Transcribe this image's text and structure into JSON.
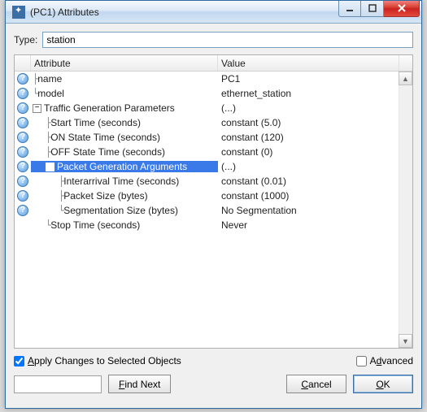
{
  "window": {
    "title": "(PC1) Attributes"
  },
  "type": {
    "label": "Type:",
    "value": "station"
  },
  "columns": {
    "attribute": "Attribute",
    "value": "Value"
  },
  "rows": [
    {
      "indent": 0,
      "branch": "mid",
      "exp": "",
      "label": "name",
      "value": "PC1",
      "help": true,
      "selected": false
    },
    {
      "indent": 0,
      "branch": "last",
      "exp": "",
      "label": "model",
      "value": "ethernet_station",
      "help": true,
      "selected": false
    },
    {
      "indent": 0,
      "branch": "",
      "exp": "minus",
      "label": "Traffic Generation Parameters",
      "value": "(...)",
      "help": true,
      "selected": false
    },
    {
      "indent": 1,
      "branch": "mid",
      "exp": "",
      "label": "Start Time (seconds)",
      "value": "constant (5.0)",
      "help": true,
      "selected": false
    },
    {
      "indent": 1,
      "branch": "mid",
      "exp": "",
      "label": "ON State Time (seconds)",
      "value": "constant (120)",
      "help": true,
      "selected": false
    },
    {
      "indent": 1,
      "branch": "mid",
      "exp": "",
      "label": "OFF State Time (seconds)",
      "value": "constant (0)",
      "help": true,
      "selected": false
    },
    {
      "indent": 1,
      "branch": "mid",
      "exp": "minus",
      "label": "Packet Generation Arguments",
      "value": "(...)",
      "help": true,
      "selected": true
    },
    {
      "indent": 2,
      "branch": "mid",
      "exp": "",
      "label": "Interarrival Time (seconds)",
      "value": "constant (0.01)",
      "help": true,
      "selected": false
    },
    {
      "indent": 2,
      "branch": "mid",
      "exp": "",
      "label": "Packet Size (bytes)",
      "value": "constant (1000)",
      "help": true,
      "selected": false
    },
    {
      "indent": 2,
      "branch": "last",
      "exp": "",
      "label": "Segmentation Size (bytes)",
      "value": "No Segmentation",
      "help": true,
      "selected": false
    },
    {
      "indent": 1,
      "branch": "last",
      "exp": "",
      "label": "Stop Time (seconds)",
      "value": "Never",
      "help": false,
      "selected": false
    }
  ],
  "footer": {
    "apply_label_pre": "Apply Changes to Selected Objects",
    "apply_checked": true,
    "advanced_label_pre": "Advanced",
    "advanced_checked": false,
    "find_next": "Find Next",
    "cancel": "Cancel",
    "ok": "OK"
  }
}
